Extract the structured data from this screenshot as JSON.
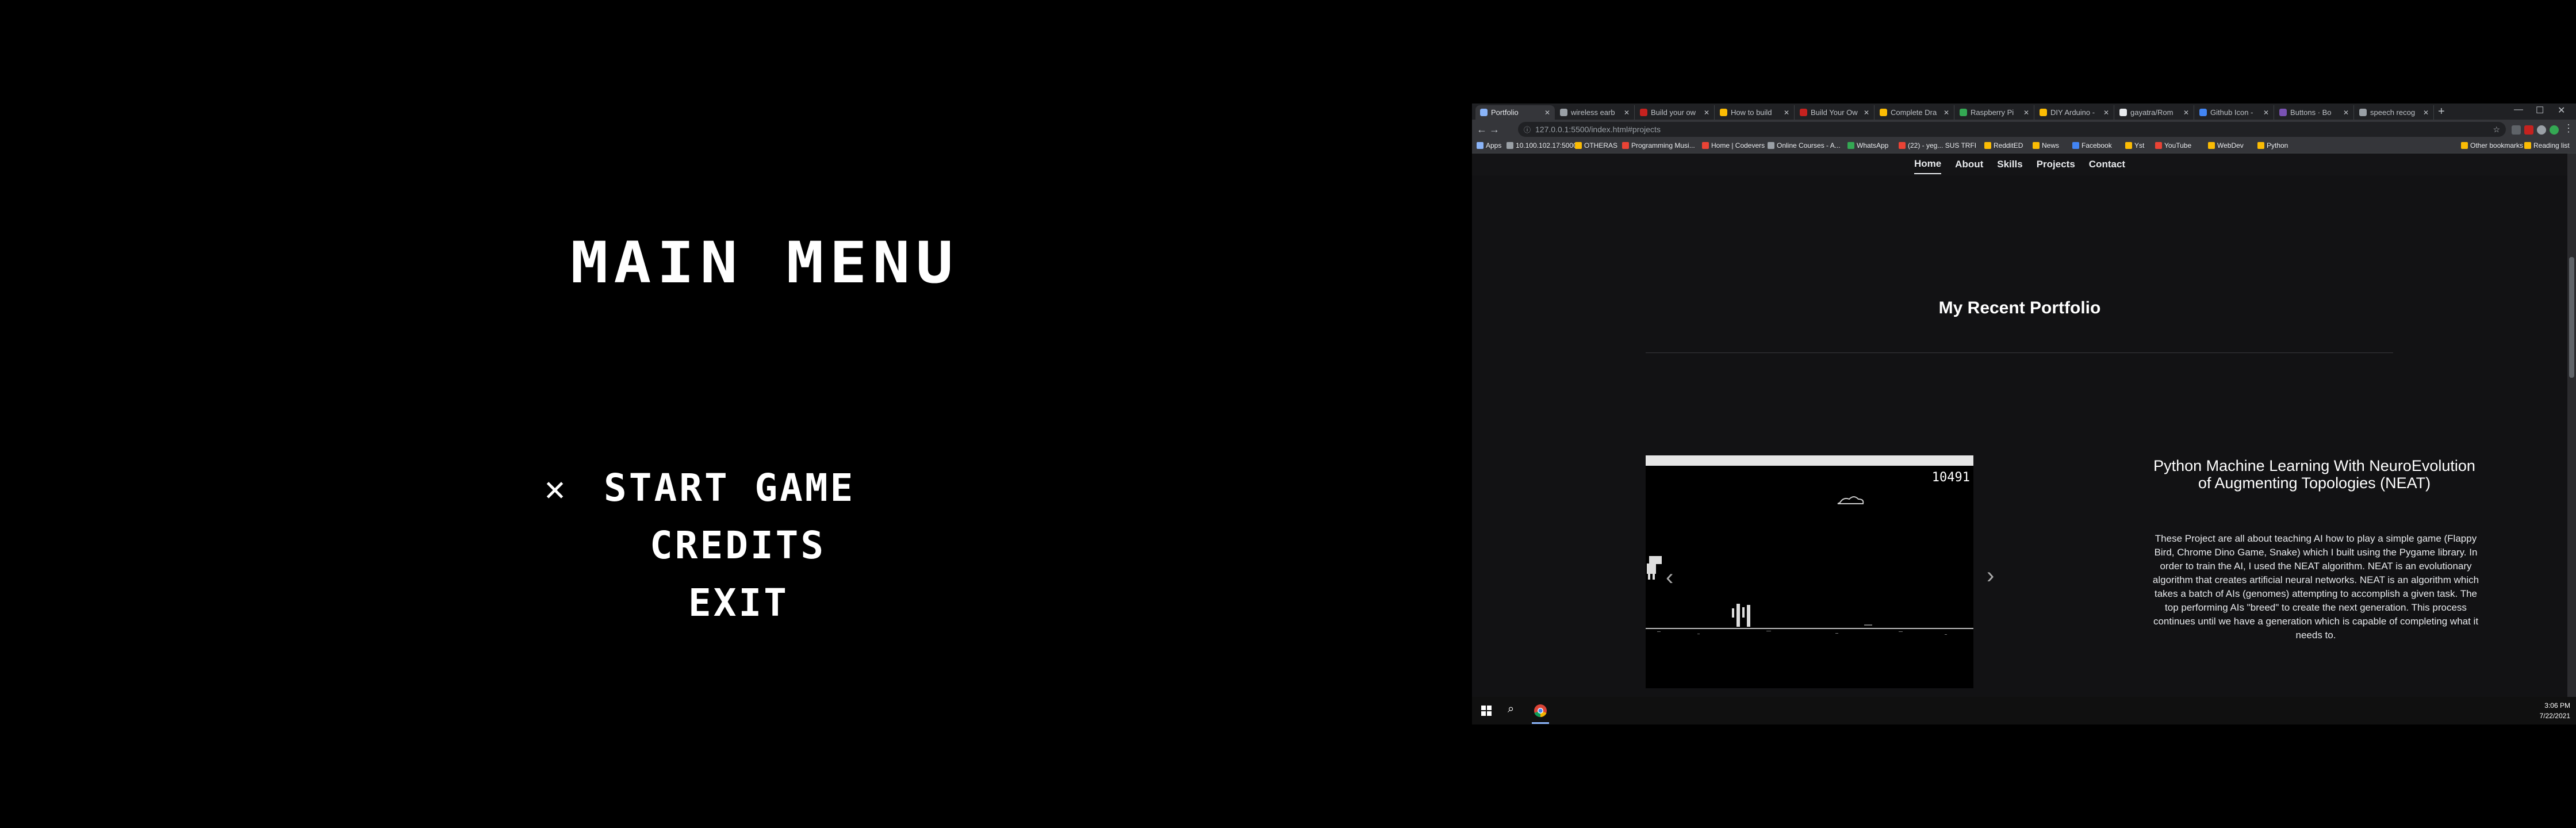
{
  "game": {
    "title": "MAIN MENU",
    "cursor": "✕",
    "items": [
      "START GAME",
      "CREDITS",
      "EXIT"
    ]
  },
  "browser": {
    "tabs": [
      {
        "label": "Portfolio",
        "color": "#8ab4f8"
      },
      {
        "label": "wireless earb",
        "color": "#9aa0a6"
      },
      {
        "label": "Build your ow",
        "color": "#c5221f"
      },
      {
        "label": "How to build",
        "color": "#fbbc04"
      },
      {
        "label": "Build Your Ow",
        "color": "#c5221f"
      },
      {
        "label": "Complete Dra",
        "color": "#fbbc04"
      },
      {
        "label": "Raspberry Pi",
        "color": "#34a853"
      },
      {
        "label": "DIY Arduino -",
        "color": "#fbbc04"
      },
      {
        "label": "gayatra/Rom",
        "color": "#e8eaed"
      },
      {
        "label": "Github Icon -",
        "color": "#4285f4"
      },
      {
        "label": "Buttons · Bo",
        "color": "#7952b3"
      },
      {
        "label": "speech recog",
        "color": "#9aa0a6"
      }
    ],
    "new_tab": "+",
    "url": "127.0.0.1:5500/index.html#projects",
    "bookmarks": [
      {
        "label": "Apps",
        "color": "#8ab4f8"
      },
      {
        "label": "10.100.102.17:5000",
        "color": "#9aa0a6"
      },
      {
        "label": "OTHERAS",
        "color": "#fbbc04"
      },
      {
        "label": "Programming Musi...",
        "color": "#ea4335"
      },
      {
        "label": "Home | Codevers",
        "color": "#ea4335"
      },
      {
        "label": "Online Courses - A...",
        "color": "#9aa0a6"
      },
      {
        "label": "WhatsApp",
        "color": "#34a853"
      },
      {
        "label": "(22) - yeg... SUS TRFI",
        "color": "#ea4335"
      },
      {
        "label": "RedditED",
        "color": "#fbbc04"
      },
      {
        "label": "News",
        "color": "#fbbc04"
      },
      {
        "label": "Facebook",
        "color": "#4285f4"
      },
      {
        "label": "Yst",
        "color": "#fbbc04"
      },
      {
        "label": "YouTube",
        "color": "#ea4335"
      },
      {
        "label": "WebDev",
        "color": "#fbbc04"
      },
      {
        "label": "Python",
        "color": "#fbbc04"
      }
    ],
    "other_bookmarks": "Other bookmarks",
    "reading_list": "Reading list"
  },
  "site": {
    "nav": [
      "Home",
      "About",
      "Skills",
      "Projects",
      "Contact"
    ],
    "nav_active": "Home",
    "section_title": "My Recent Portfolio",
    "carousel": {
      "score": "10491",
      "prev": "‹",
      "next": "›"
    },
    "project_title": "Python Machine Learning With NeuroEvolution of Augmenting Topologies (NEAT)",
    "project_desc": "These Project are all about teaching AI how to play a simple game (Flappy Bird, Chrome Dino Game, Snake) which I built using the Pygame library. In order to train the AI, I used the NEAT algorithm. NEAT is an evolutionary algorithm that creates artificial neural networks. NEAT is an algorithm which takes a batch of AIs (genomes) attempting to accomplish a given task. The top performing AIs \"breed\" to create the next generation. This process continues until we have a generation which is capable of completing what it needs to."
  },
  "taskbar": {
    "time": "3:06 PM",
    "date": "7/22/2021"
  }
}
